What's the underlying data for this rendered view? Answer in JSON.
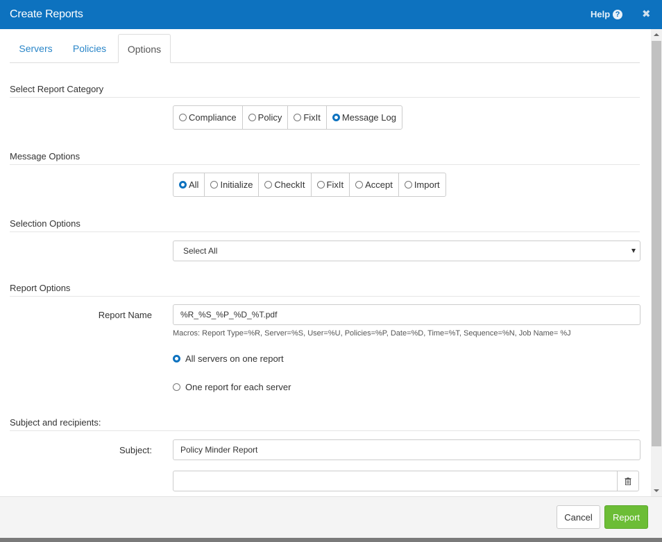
{
  "window": {
    "title": "Create Reports",
    "help_label": "Help",
    "help_icon": "question-circle-icon",
    "close_icon": "times-icon"
  },
  "tabs": [
    {
      "label": "Servers",
      "active": false
    },
    {
      "label": "Policies",
      "active": false
    },
    {
      "label": "Options",
      "active": true
    }
  ],
  "report_category": {
    "title": "Select Report Category",
    "options": [
      "Compliance",
      "Policy",
      "FixIt",
      "Message Log"
    ],
    "selected": "Message Log"
  },
  "message_options": {
    "title": "Message Options",
    "options": [
      "All",
      "Initialize",
      "CheckIt",
      "FixIt",
      "Accept",
      "Import"
    ],
    "selected": "All"
  },
  "selection_options": {
    "title": "Selection Options",
    "selected_value": "Select All"
  },
  "report_options": {
    "title": "Report Options",
    "report_name_label": "Report Name",
    "report_name_value": "%R_%S_%P_%D_%T.pdf",
    "macros_hint": "Macros: Report Type=%R, Server=%S, User=%U, Policies=%P, Date=%D, Time=%T, Sequence=%N, Job Name= %J",
    "layout_options": [
      "All servers on one report",
      "One report for each server"
    ],
    "layout_selected": "All servers on one report"
  },
  "subject_recipients": {
    "title": "Subject and recipients:",
    "subject_label": "Subject:",
    "subject_value": "Policy Minder Report",
    "recipient_value": "",
    "trash_icon": "trash-icon"
  },
  "footer": {
    "cancel_label": "Cancel",
    "report_label": "Report"
  },
  "colors": {
    "header": "#0d72bf",
    "accent": "#0d72bf",
    "report_button": "#6cbd36",
    "tab_link": "#2a86c8"
  }
}
